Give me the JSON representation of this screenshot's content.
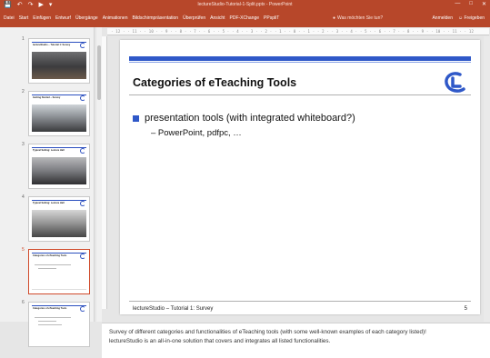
{
  "window": {
    "title": "lectureStudio-Tutorial-1-Split.pptx - PowerPoint",
    "controls": [
      "—",
      "□",
      "✕"
    ]
  },
  "quick_access": {
    "icons": [
      "save-icon",
      "undo-icon",
      "redo-icon",
      "present-icon",
      "customize-icon"
    ],
    "glyphs": [
      "💾",
      "↶",
      "↷",
      "▶",
      "▾"
    ]
  },
  "ribbon": {
    "tabs": [
      "Datei",
      "Start",
      "Einfügen",
      "Entwurf",
      "Übergänge",
      "Animationen",
      "Bildschirmpräsentation",
      "Überprüfen",
      "Ansicht",
      "PDF-XChange",
      "PPspliT"
    ],
    "tell_me": "Was möchten Sie tun?",
    "sign_in": "Anmelden",
    "share": "Freigeben"
  },
  "ruler": {
    "labels": "· 12 · · 11 · · 10 · · 9 · · 8 · · 7 · · 6 · · 5 · · 4 · · 3 · · 2 · · 1 · · 0 · · 1 · · 2 · · 3 · · 4 · · 5 · · 6 · · 7 · · 8 · · 9 · · 10 · · 11 · · 12"
  },
  "thumbnails": [
    {
      "num": "1",
      "title": "lectureStudio – Tutorial 1: Survey"
    },
    {
      "num": "2",
      "title": "Getting Started – Survey"
    },
    {
      "num": "3",
      "title": "Typical Setting: Lecture Hall"
    },
    {
      "num": "4",
      "title": "Typical Setting: Lecture Hall"
    },
    {
      "num": "5",
      "title": "Categories of eTeaching Tools"
    },
    {
      "num": "6",
      "title": "Categories of eTeaching Tools"
    }
  ],
  "slide": {
    "title": "Categories of eTeaching Tools",
    "bullet_1": "presentation tools (with integrated whiteboard?)",
    "bullet_1_sub": "–  PowerPoint, pdfpc, …",
    "footer": "lectureStudio – Tutorial 1: Survey",
    "page_number": "5",
    "accent_color": "#2f58c8"
  },
  "notes": {
    "line_1": "Survey of different categories and functionalities of eTeaching tools (with some well-known examples of each category listed)!",
    "line_2": "lectureStudio is an all-in-one solution that covers and integrates all listed functionalities."
  }
}
